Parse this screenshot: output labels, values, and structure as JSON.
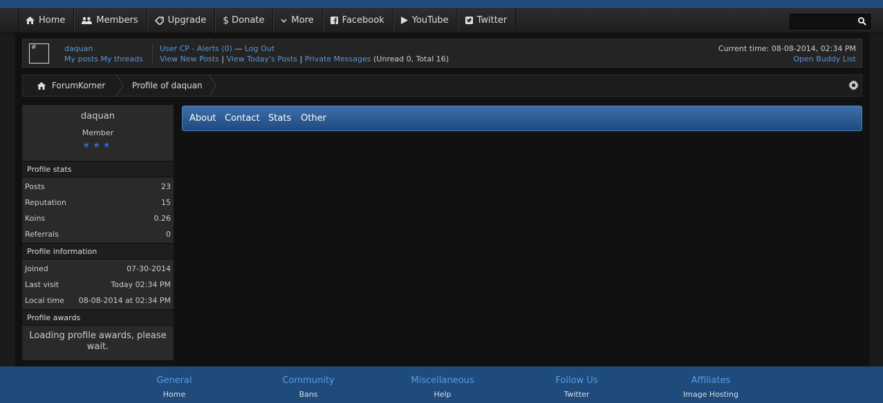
{
  "nav": {
    "items": [
      {
        "label": "Home",
        "icon": "home-icon"
      },
      {
        "label": "Members",
        "icon": "members-icon"
      },
      {
        "label": "Upgrade",
        "icon": "tag-icon"
      },
      {
        "label": "Donate",
        "icon": "dollar-icon"
      },
      {
        "label": "More",
        "icon": "chevron-down-icon"
      },
      {
        "label": "Facebook",
        "icon": "facebook-icon"
      },
      {
        "label": "YouTube",
        "icon": "play-icon"
      },
      {
        "label": "Twitter",
        "icon": "twitter-icon"
      }
    ],
    "search_value": ""
  },
  "userbar": {
    "avatar_text": "#",
    "username": "daquan",
    "my_posts": "My posts",
    "my_threads": "My threads",
    "user_cp": "User CP",
    "dash1": "-",
    "alerts": "Alerts (0)",
    "dash2": "—",
    "log_out": "Log Out",
    "view_new_posts": "View New Posts",
    "pipe": "|",
    "view_todays_posts": "View Today's Posts",
    "private_messages": "Private Messages",
    "pm_counts": "(Unread 0, Total 16)",
    "current_time": "Current time: 08-08-2014, 02:34 PM",
    "buddy_list": "Open Buddy List"
  },
  "breadcrumb": {
    "home": "ForumKorner",
    "current": "Profile of daquan"
  },
  "profile": {
    "name": "daquan",
    "role": "Member",
    "stars": "★★★",
    "stats_title": "Profile stats",
    "stats": [
      {
        "label": "Posts",
        "value": "23"
      },
      {
        "label": "Reputation",
        "value": "15"
      },
      {
        "label": "Koins",
        "value": "0.26"
      },
      {
        "label": "Referrals",
        "value": "0"
      }
    ],
    "info_title": "Profile information",
    "info": [
      {
        "label": "Joined",
        "value": "07-30-2014"
      },
      {
        "label": "Last visit",
        "value": "Today 02:34 PM"
      },
      {
        "label": "Local time",
        "value": "08-08-2014 at 02:34 PM"
      }
    ],
    "awards_title": "Profile awards",
    "awards_loading": "Loading profile awards, please wait."
  },
  "tabs": [
    "About",
    "Contact",
    "Stats",
    "Other"
  ],
  "footer": [
    {
      "heading": "General",
      "link": "Home"
    },
    {
      "heading": "Community",
      "link": "Bans"
    },
    {
      "heading": "Miscellaneous",
      "link": "Help"
    },
    {
      "heading": "Follow Us",
      "link": "Twitter"
    },
    {
      "heading": "Affiliates",
      "link": "Image Hosting"
    }
  ],
  "colors": {
    "accent": "#1f4a7c",
    "link": "#5a95d2",
    "star": "#2d6cc0"
  }
}
